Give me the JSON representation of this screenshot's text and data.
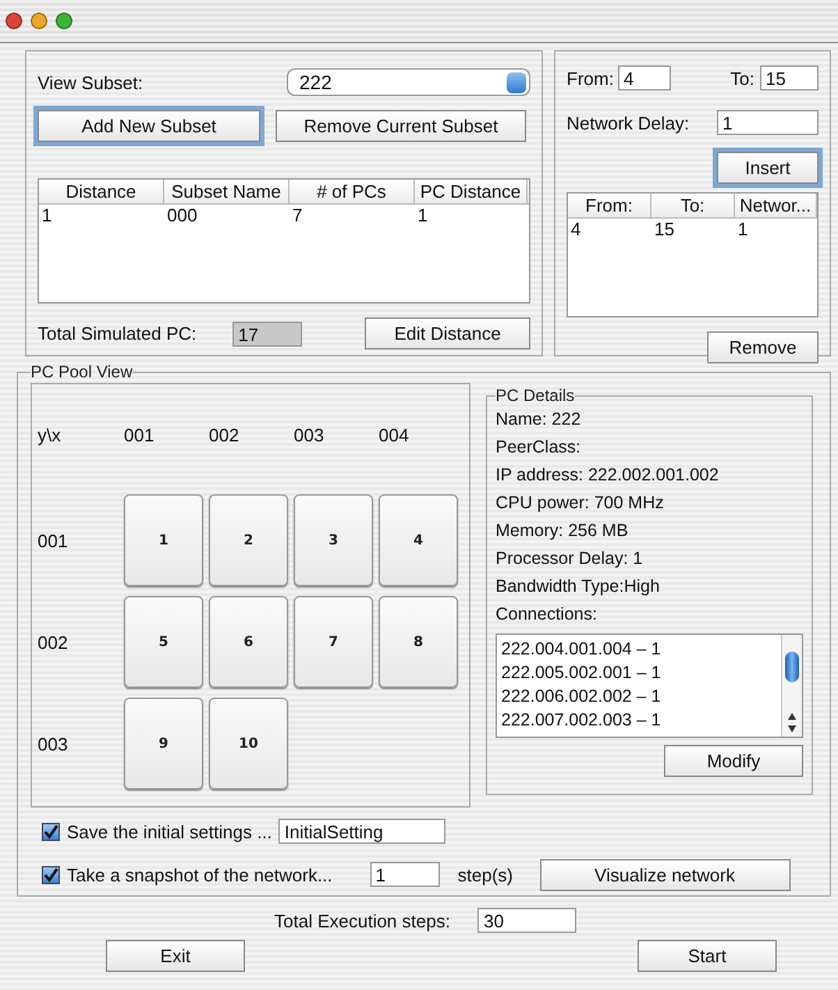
{
  "subsets": {
    "view_label": "View Subset:",
    "view_value": "222",
    "add_button": {
      "label": "Add New Subset",
      "focused": true
    },
    "remove_button": {
      "label": "Remove Current Subset",
      "focused": false
    },
    "table": {
      "columns": [
        "Distance",
        "Subset Name",
        "# of PCs",
        "PC Distance"
      ],
      "rows": [
        [
          "1",
          "000",
          "7",
          "1"
        ]
      ]
    },
    "total_label": "Total Simulated PC:",
    "total_value": "17",
    "edit_button": {
      "label": "Edit Distance",
      "focused": false
    }
  },
  "delays": {
    "from_label": "From:",
    "from_value": "4",
    "to_label": "To:",
    "to_value": "15",
    "delay_label": "Network Delay:",
    "delay_value": "1",
    "insert_button": {
      "label": "Insert",
      "focused": true
    },
    "table": {
      "columns": [
        "From:",
        "To:",
        "Networ..."
      ],
      "rows": [
        [
          "4",
          "15",
          "1"
        ]
      ]
    },
    "remove_button": {
      "label": "Remove",
      "focused": false
    }
  },
  "pool": {
    "title": "PC Pool View",
    "corner": "y\\x",
    "columns": [
      "001",
      "002",
      "003",
      "004"
    ],
    "rows": [
      {
        "label": "001",
        "pcs": [
          "1",
          "2",
          "3",
          "4"
        ]
      },
      {
        "label": "002",
        "pcs": [
          "5",
          "6",
          "7",
          "8"
        ]
      },
      {
        "label": "003",
        "pcs": [
          "9",
          "10"
        ]
      }
    ]
  },
  "details": {
    "title": "PC Details",
    "lines": [
      "Name: 222",
      "PeerClass:",
      "IP address: 222.002.001.002",
      "CPU power: 700 MHz",
      "Memory: 256 MB",
      "Processor Delay: 1",
      "Bandwidth Type:High",
      "Connections:"
    ],
    "connections": [
      "222.004.001.004 – 1",
      "222.005.002.001 – 1",
      "222.006.002.002 – 1",
      "222.007.002.003 – 1"
    ],
    "modify_button": "Modify"
  },
  "save": {
    "label": "Save the initial settings ...",
    "checked": true,
    "value": "InitialSetting"
  },
  "snapshot": {
    "label": "Take a snapshot of the network...",
    "checked": true,
    "value": "1",
    "unit": "step(s)",
    "button": "Visualize network"
  },
  "steps": {
    "label": "Total Execution steps:",
    "value": "30"
  },
  "buttons": [
    "Exit",
    "Start"
  ]
}
